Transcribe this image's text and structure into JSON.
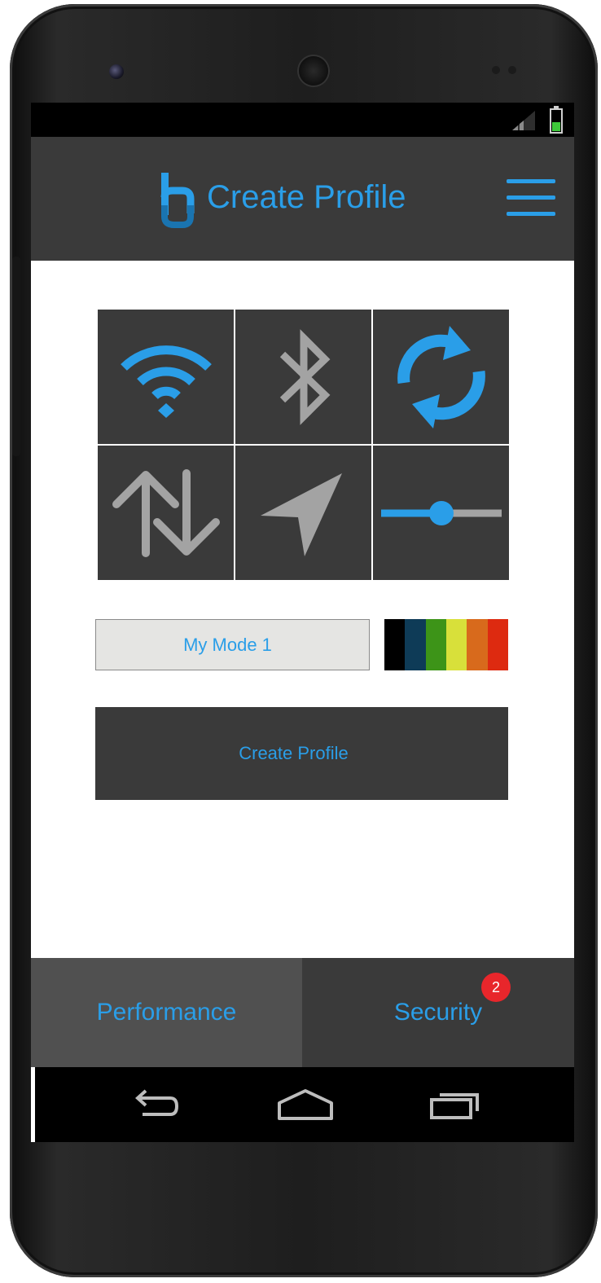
{
  "app": {
    "title": "Create Profile"
  },
  "profile": {
    "mode_name": "My Mode 1",
    "create_label": "Create Profile"
  },
  "toggles": [
    {
      "icon": "wifi-icon",
      "active": true
    },
    {
      "icon": "bluetooth-icon",
      "active": false
    },
    {
      "icon": "sync-icon",
      "active": true
    },
    {
      "icon": "data-transfer-icon",
      "active": false
    },
    {
      "icon": "location-icon",
      "active": false
    },
    {
      "icon": "brightness-slider-icon",
      "active": true,
      "level": 0.5
    }
  ],
  "color_palette": [
    "#000000",
    "#0e3b57",
    "#3d9418",
    "#d8e03a",
    "#d86a1c",
    "#dd2a10"
  ],
  "tabs": {
    "performance_label": "Performance",
    "security_label": "Security",
    "security_badge": "2"
  },
  "colors": {
    "accent": "#2a9ee8",
    "inactive_icon": "#a3a3a3",
    "tile_bg": "#3a3a3a",
    "badge": "#e8262b"
  },
  "nav": {
    "back": "back-icon",
    "home": "home-icon",
    "recents": "recents-icon"
  }
}
